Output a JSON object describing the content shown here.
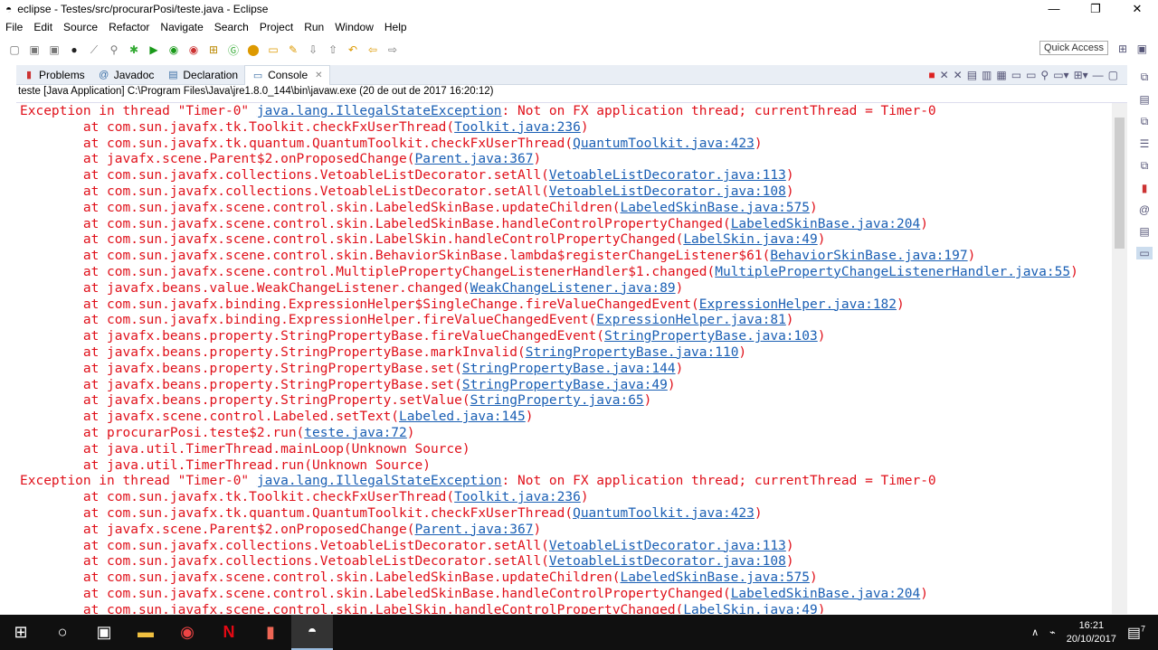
{
  "window": {
    "title": "eclipse - Testes/src/procurarPosi/teste.java - Eclipse",
    "minimize": "—",
    "maximize": "❐",
    "close": "✕"
  },
  "menu": [
    "File",
    "Edit",
    "Source",
    "Refactor",
    "Navigate",
    "Search",
    "Project",
    "Run",
    "Window",
    "Help"
  ],
  "quick_access": "Quick Access",
  "tabs": [
    {
      "label": "Problems",
      "icon": "problems-icon"
    },
    {
      "label": "Javadoc",
      "icon": "at-icon"
    },
    {
      "label": "Declaration",
      "icon": "declaration-icon"
    },
    {
      "label": "Console",
      "icon": "console-icon",
      "close": "✕"
    }
  ],
  "process": "teste [Java Application] C:\\Program Files\\Java\\jre1.8.0_144\\bin\\javaw.exe (20 de out de 2017 16:20:12)",
  "console_lines": [
    {
      "pre": "Exception in thread \"Timer-0\" ",
      "link": "java.lang.IllegalStateException",
      "post": ": Not on FX application thread; currentThread = Timer-0"
    },
    {
      "pre": "\tat com.sun.javafx.tk.Toolkit.checkFxUserThread(",
      "link": "Toolkit.java:236",
      "post": ")"
    },
    {
      "pre": "\tat com.sun.javafx.tk.quantum.QuantumToolkit.checkFxUserThread(",
      "link": "QuantumToolkit.java:423",
      "post": ")"
    },
    {
      "pre": "\tat javafx.scene.Parent$2.onProposedChange(",
      "link": "Parent.java:367",
      "post": ")"
    },
    {
      "pre": "\tat com.sun.javafx.collections.VetoableListDecorator.setAll(",
      "link": "VetoableListDecorator.java:113",
      "post": ")"
    },
    {
      "pre": "\tat com.sun.javafx.collections.VetoableListDecorator.setAll(",
      "link": "VetoableListDecorator.java:108",
      "post": ")"
    },
    {
      "pre": "\tat com.sun.javafx.scene.control.skin.LabeledSkinBase.updateChildren(",
      "link": "LabeledSkinBase.java:575",
      "post": ")"
    },
    {
      "pre": "\tat com.sun.javafx.scene.control.skin.LabeledSkinBase.handleControlPropertyChanged(",
      "link": "LabeledSkinBase.java:204",
      "post": ")"
    },
    {
      "pre": "\tat com.sun.javafx.scene.control.skin.LabelSkin.handleControlPropertyChanged(",
      "link": "LabelSkin.java:49",
      "post": ")"
    },
    {
      "pre": "\tat com.sun.javafx.scene.control.skin.BehaviorSkinBase.lambda$registerChangeListener$61(",
      "link": "BehaviorSkinBase.java:197",
      "post": ")"
    },
    {
      "pre": "\tat com.sun.javafx.scene.control.MultiplePropertyChangeListenerHandler$1.changed(",
      "link": "MultiplePropertyChangeListenerHandler.java:55",
      "post": ")"
    },
    {
      "pre": "\tat javafx.beans.value.WeakChangeListener.changed(",
      "link": "WeakChangeListener.java:89",
      "post": ")"
    },
    {
      "pre": "\tat com.sun.javafx.binding.ExpressionHelper$SingleChange.fireValueChangedEvent(",
      "link": "ExpressionHelper.java:182",
      "post": ")"
    },
    {
      "pre": "\tat com.sun.javafx.binding.ExpressionHelper.fireValueChangedEvent(",
      "link": "ExpressionHelper.java:81",
      "post": ")"
    },
    {
      "pre": "\tat javafx.beans.property.StringPropertyBase.fireValueChangedEvent(",
      "link": "StringPropertyBase.java:103",
      "post": ")"
    },
    {
      "pre": "\tat javafx.beans.property.StringPropertyBase.markInvalid(",
      "link": "StringPropertyBase.java:110",
      "post": ")"
    },
    {
      "pre": "\tat javafx.beans.property.StringPropertyBase.set(",
      "link": "StringPropertyBase.java:144",
      "post": ")"
    },
    {
      "pre": "\tat javafx.beans.property.StringPropertyBase.set(",
      "link": "StringPropertyBase.java:49",
      "post": ")"
    },
    {
      "pre": "\tat javafx.beans.property.StringProperty.setValue(",
      "link": "StringProperty.java:65",
      "post": ")"
    },
    {
      "pre": "\tat javafx.scene.control.Labeled.setText(",
      "link": "Labeled.java:145",
      "post": ")"
    },
    {
      "pre": "\tat procurarPosi.teste$2.run(",
      "link": "teste.java:72",
      "post": ")"
    },
    {
      "pre": "\tat java.util.TimerThread.mainLoop(Unknown Source)",
      "link": "",
      "post": ""
    },
    {
      "pre": "\tat java.util.TimerThread.run(Unknown Source)",
      "link": "",
      "post": ""
    },
    {
      "pre": "Exception in thread \"Timer-0\" ",
      "link": "java.lang.IllegalStateException",
      "post": ": Not on FX application thread; currentThread = Timer-0"
    },
    {
      "pre": "\tat com.sun.javafx.tk.Toolkit.checkFxUserThread(",
      "link": "Toolkit.java:236",
      "post": ")"
    },
    {
      "pre": "\tat com.sun.javafx.tk.quantum.QuantumToolkit.checkFxUserThread(",
      "link": "QuantumToolkit.java:423",
      "post": ")"
    },
    {
      "pre": "\tat javafx.scene.Parent$2.onProposedChange(",
      "link": "Parent.java:367",
      "post": ")"
    },
    {
      "pre": "\tat com.sun.javafx.collections.VetoableListDecorator.setAll(",
      "link": "VetoableListDecorator.java:113",
      "post": ")"
    },
    {
      "pre": "\tat com.sun.javafx.collections.VetoableListDecorator.setAll(",
      "link": "VetoableListDecorator.java:108",
      "post": ")"
    },
    {
      "pre": "\tat com.sun.javafx.scene.control.skin.LabeledSkinBase.updateChildren(",
      "link": "LabeledSkinBase.java:575",
      "post": ")"
    },
    {
      "pre": "\tat com.sun.javafx.scene.control.skin.LabeledSkinBase.handleControlPropertyChanged(",
      "link": "LabeledSkinBase.java:204",
      "post": ")"
    },
    {
      "pre": "\tat com.sun.javafx.scene.control.skin.LabelSkin.handleControlPropertyChanged(",
      "link": "LabelSkin.java:49",
      "post": ")"
    }
  ],
  "taskbar": {
    "time": "16:21",
    "date": "20/10/2017",
    "notifications": "7"
  }
}
